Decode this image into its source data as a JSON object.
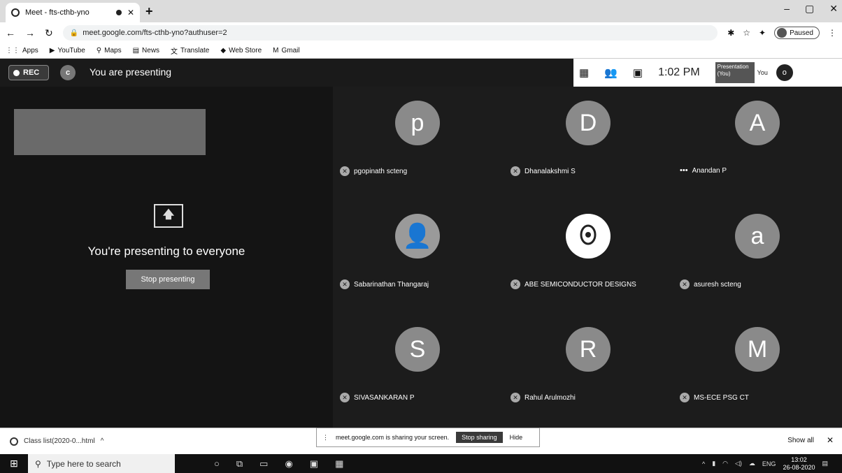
{
  "browser": {
    "tab_title": "Meet - fts-cthb-yno",
    "url": "meet.google.com/fts-cthb-yno?authuser=2",
    "profile_status": "Paused",
    "bookmarks": [
      "Apps",
      "YouTube",
      "Maps",
      "News",
      "Translate",
      "Web Store",
      "Gmail"
    ]
  },
  "meet": {
    "rec_label": "REC",
    "self_initial": "c",
    "presenting_title": "You are presenting",
    "time": "1:02 PM",
    "presentation_tile": "Presentation (You)",
    "you_label": "You",
    "you_initial": "o",
    "present_message": "You're presenting to everyone",
    "stop_presenting": "Stop presenting",
    "participants": [
      {
        "initial": "p",
        "name": "pgopinath scteng",
        "kind": "letter"
      },
      {
        "initial": "D",
        "name": "Dhanalakshmi S",
        "kind": "letter"
      },
      {
        "initial": "A",
        "name": "Anandan P",
        "kind": "letter"
      },
      {
        "initial": "",
        "name": "Sabarinathan Thangaraj",
        "kind": "photo"
      },
      {
        "initial": "",
        "name": "ABE SEMICONDUCTOR DESIGNS",
        "kind": "logo"
      },
      {
        "initial": "a",
        "name": "asuresh scteng",
        "kind": "letter"
      },
      {
        "initial": "S",
        "name": "SIVASANKARAN P",
        "kind": "letter"
      },
      {
        "initial": "R",
        "name": "Rahul Arulmozhi",
        "kind": "letter"
      },
      {
        "initial": "M",
        "name": "MS-ECE PSG CT",
        "kind": "letter"
      }
    ]
  },
  "sharebar": {
    "message": "meet.google.com is sharing your screen.",
    "stop_sharing": "Stop sharing",
    "hide": "Hide"
  },
  "downloads": {
    "file": "Class list(2020-0...html",
    "show_all": "Show all"
  },
  "taskbar": {
    "search_placeholder": "Type here to search",
    "tray_lang": "ENG",
    "clock_time": "13:02",
    "clock_date": "26-08-2020"
  }
}
